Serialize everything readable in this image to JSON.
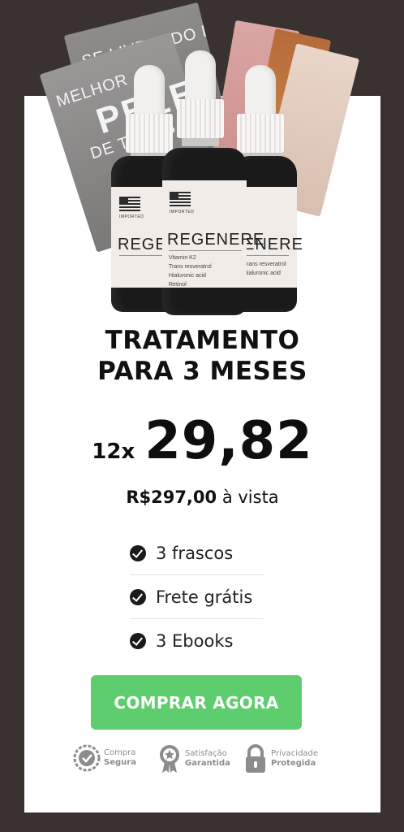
{
  "product_image": {
    "book_titles": [
      "SE LIVRANDO DA",
      "MELHOR",
      "PELE",
      "DE TODAS"
    ],
    "bottle_brand": "REGENERE",
    "bottle_brand_partial": "ENERE",
    "bottle_origin": "IMPORTED",
    "ingredients": [
      "Vitamin K2",
      "Trans resveratrol",
      "Hialuronic acid",
      "Retinol"
    ],
    "colors": {
      "glass": "#1b1a1a",
      "label": "#f1ece8",
      "dropper": "#f2f0ee"
    }
  },
  "offer": {
    "headline_line1": "TRATAMENTO",
    "headline_line2": "PARA 3 MESES",
    "installments": "12x",
    "installment_price": "29,82",
    "cash_price": "R$297,00",
    "cash_suffix": " à vista"
  },
  "features": [
    {
      "label": "3 frascos",
      "icon": "check-circle-icon"
    },
    {
      "label": "Frete grátis",
      "icon": "check-circle-icon"
    },
    {
      "label": "3 Ebooks",
      "icon": "check-circle-icon"
    }
  ],
  "cta": {
    "label": "COMPRAR AGORA",
    "color": "#5dcd6e"
  },
  "trust_badges": [
    {
      "line1": "Compra",
      "line2": "Segura",
      "icon": "shield-check-icon"
    },
    {
      "line1": "Satisfação",
      "line2": "Garantida",
      "icon": "award-ribbon-icon"
    },
    {
      "line1": "Privacidade",
      "line2": "Protegida",
      "icon": "padlock-icon"
    }
  ],
  "colors": {
    "background": "#3a3230",
    "card": "#ffffff",
    "text": "#111111",
    "badge": "#8c8c8c"
  }
}
